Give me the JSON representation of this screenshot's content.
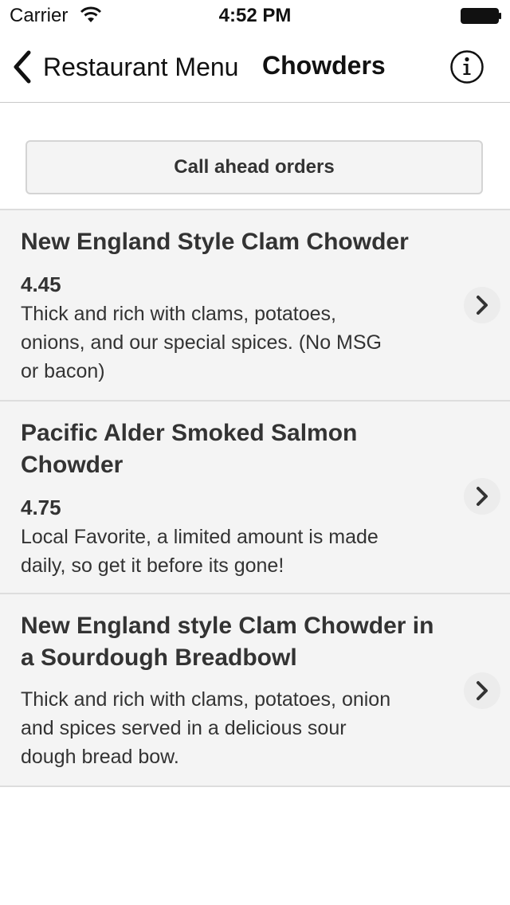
{
  "status_bar": {
    "carrier": "Carrier",
    "time": "4:52 PM",
    "wifi_icon": "wifi-icon",
    "battery_icon": "battery-icon"
  },
  "nav": {
    "back_label": "Restaurant Menu",
    "back_icon": "chevron-left-icon",
    "title": "Chowders",
    "info_icon": "info-icon"
  },
  "call_button": {
    "label": "Call ahead orders"
  },
  "items": [
    {
      "name": "New England Style Clam Chowder",
      "price": "4.45",
      "description": "Thick and rich with clams, potatoes, onions, and our special spices. (No MSG or bacon)"
    },
    {
      "name": "Pacific Alder Smoked Salmon Chowder",
      "price": "4.75",
      "description": "Local Favorite, a limited amount is made daily, so get it before its gone!"
    },
    {
      "name": "New England style Clam Chowder in a Sourdough Breadbowl",
      "price": "",
      "description": "Thick and rich with clams, potatoes, onion and spices served in a delicious sour dough bread bow."
    }
  ],
  "colors": {
    "row_background": "#f4f4f4",
    "separator": "#dddddd",
    "text": "#333333"
  }
}
